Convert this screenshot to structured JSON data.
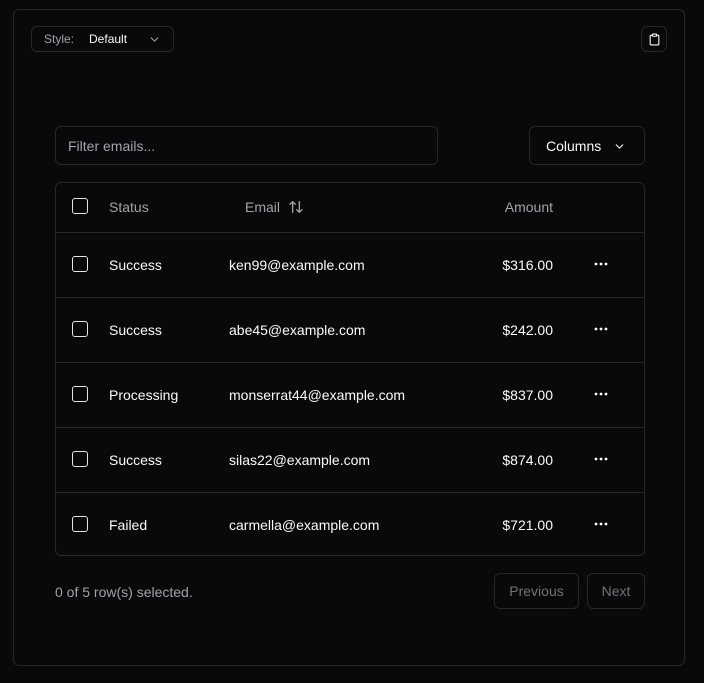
{
  "toolbar": {
    "style_label": "Style:",
    "style_value": "Default",
    "copy_icon": "clipboard-icon"
  },
  "filter": {
    "placeholder": "Filter emails...",
    "value": ""
  },
  "columns_button": {
    "label": "Columns",
    "icon": "chevron-down-icon"
  },
  "table": {
    "headers": {
      "status": "Status",
      "email": "Email",
      "amount": "Amount"
    },
    "rows": [
      {
        "status": "Success",
        "email": "ken99@example.com",
        "amount": "$316.00"
      },
      {
        "status": "Success",
        "email": "abe45@example.com",
        "amount": "$242.00"
      },
      {
        "status": "Processing",
        "email": "monserrat44@example.com",
        "amount": "$837.00"
      },
      {
        "status": "Success",
        "email": "silas22@example.com",
        "amount": "$874.00"
      },
      {
        "status": "Failed",
        "email": "carmella@example.com",
        "amount": "$721.00"
      }
    ]
  },
  "footer": {
    "selection_text": "0 of 5 row(s) selected.",
    "previous_label": "Previous",
    "next_label": "Next"
  },
  "colors": {
    "background": "#09090b",
    "border": "#27272a",
    "text": "#fafafa",
    "muted": "#a1a1aa",
    "disabled": "#71717a"
  }
}
